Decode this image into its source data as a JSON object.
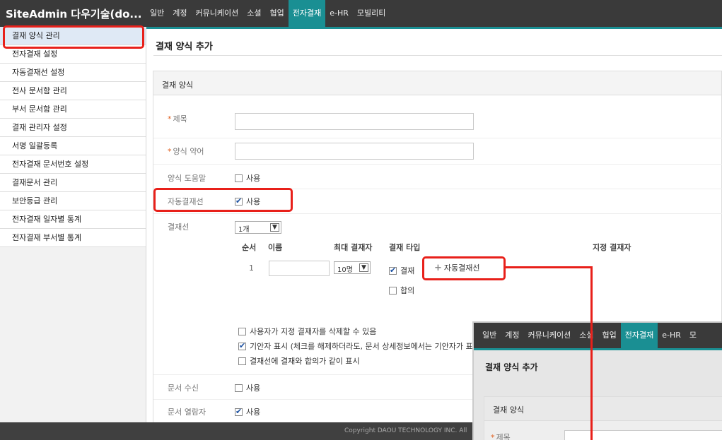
{
  "app": {
    "brand": "SiteAdmin 다우기술(do...",
    "nav": [
      "일반",
      "계정",
      "커뮤니케이션",
      "소셜",
      "협업",
      "전자결재",
      "e-HR",
      "모빌리티"
    ],
    "active_nav": "전자결재"
  },
  "sidebar": {
    "items": [
      {
        "label": "결재 양식 관리"
      },
      {
        "label": "전자결재 설정"
      },
      {
        "label": "자동결재선 설정"
      },
      {
        "label": "전사 문서함 관리"
      },
      {
        "label": "부서 문서함 관리"
      },
      {
        "label": "결재 관리자 설정"
      },
      {
        "label": "서명 일괄등록"
      },
      {
        "label": "전자결재 문서번호 설정"
      },
      {
        "label": "결재문서 관리"
      },
      {
        "label": "보안등급 관리"
      },
      {
        "label": "전자결재 일자별 통계"
      },
      {
        "label": "전자결재 부서별 통계"
      }
    ]
  },
  "main": {
    "title": "결재 양식 추가",
    "section": "결재 양식",
    "required_mark": "*",
    "fields": {
      "subject_label": "제목",
      "abbr_label": "양식 약어",
      "help_label": "양식 도움말",
      "help_check": "사용",
      "auto_line_label": "자동결재선",
      "auto_line_check": "사용",
      "approval_line_label": "결재선",
      "approval_line_count": "1개",
      "doc_receive_label": "문서 수신",
      "doc_receive_check": "사용",
      "doc_viewer_label": "문서 열람자",
      "doc_viewer_check": "사용"
    },
    "table": {
      "headers": [
        "순서",
        "이름",
        "최대 결재자",
        "결재 타입",
        "지정 결재자"
      ],
      "row": {
        "order": "1",
        "max": "10명",
        "type_approve": "결재",
        "type_agree": "합의",
        "auto_button": "자동결재선"
      }
    },
    "options": [
      "사용자가 지정 결재자를 삭제할 수 있음",
      "기안자 표시 (체크를 해제하더라도, 문서 상세정보에서는 기안자가 표",
      "결재선에 결재와 합의가 같이 표시"
    ]
  },
  "footer": {
    "text": "Copyright DAOU TECHNOLOGY INC. All"
  },
  "inset": {
    "nav": [
      "일반",
      "계정",
      "커뮤니케이션",
      "소셜",
      "협업",
      "전자결재",
      "e-HR",
      "모"
    ],
    "title": "결재 양식 추가",
    "section": "결재 양식",
    "subject_label": "제목"
  },
  "colors": {
    "accent": "#1a8f93",
    "highlight": "#e8201a",
    "topbar": "#3a3a3a"
  }
}
